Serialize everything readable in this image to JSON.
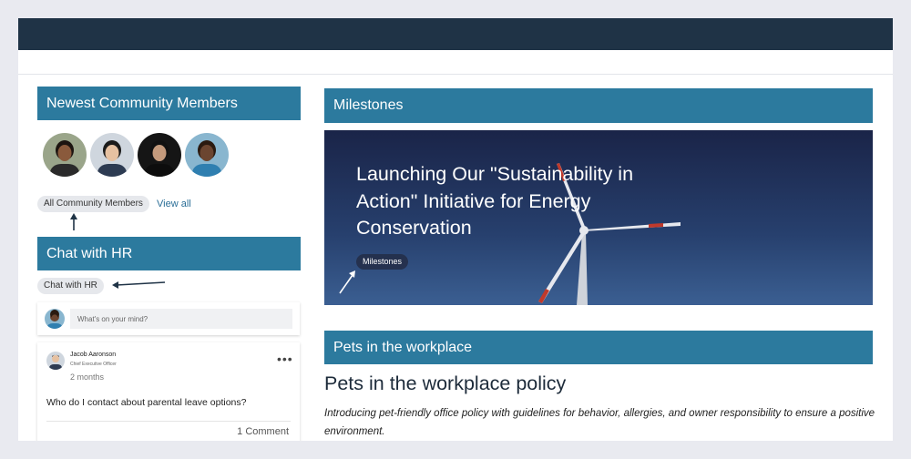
{
  "newest_members": {
    "heading": "Newest Community Members",
    "members": [
      {
        "avatar_icon": "person-avatar",
        "skin": "#8a5a3c",
        "hair": "#1c1410",
        "shirt": "#2a2a2a",
        "bg": "#9aa58a"
      },
      {
        "avatar_icon": "person-avatar",
        "skin": "#e6c1a1",
        "hair": "#1a1a1a",
        "shirt": "#2d3b52",
        "bg": "#cfd6de"
      },
      {
        "avatar_icon": "person-avatar",
        "skin": "#c49a7c",
        "hair": "#111111",
        "shirt": "#0d0d0d",
        "bg": "#151515"
      },
      {
        "avatar_icon": "person-avatar",
        "skin": "#6b4530",
        "hair": "#2a1a10",
        "shirt": "#2f7fb0",
        "bg": "#89b6cf"
      }
    ],
    "all_members_chip": "All Community Members",
    "view_all_link": "View all"
  },
  "chat_hr": {
    "heading": "Chat with HR",
    "chip": "Chat with HR",
    "composer_placeholder": "What's on your mind?",
    "post": {
      "author": "Jacob Aaronson",
      "author_title": "Chief Executive Officer",
      "time": "2 months",
      "more_icon": "more-options-icon",
      "more_glyph": "•••",
      "text": "Who do I contact about parental leave options?",
      "comments": "1 Comment"
    }
  },
  "milestones": {
    "heading": "Milestones",
    "hero_title": "Launching Our \"Sustainability in Action\" Initiative for Energy Conservation",
    "hero_chip": "Milestones"
  },
  "pets": {
    "heading": "Pets in the workplace",
    "article_title": "Pets in the workplace policy",
    "article_desc": "Introducing pet-friendly office policy with guidelines for behavior, allergies, and owner responsibility to ensure a positive environment."
  },
  "colors": {
    "topbar": "#1f3346",
    "panel_header": "#2c7a9e",
    "link": "#2a6e97",
    "annotation_arrow": "#1f3346"
  }
}
